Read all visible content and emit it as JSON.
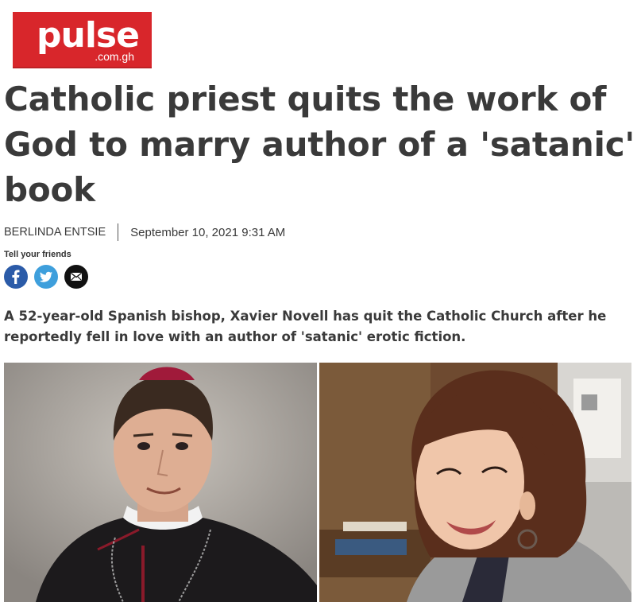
{
  "logo": {
    "brand": "pulse",
    "domain": ".com.gh"
  },
  "article": {
    "headline": "Catholic priest quits the work of God to marry author of a 'satanic' book",
    "author": "BERLINDA ENTSIE",
    "date": "September 10, 2021 9:31 AM",
    "lede": "A 52-year-old Spanish bishop, Xavier Novell has quit the Catholic Church after he reportedly fell in love with an author of 'satanic' erotic fiction."
  },
  "share": {
    "label": "Tell your friends",
    "icons": [
      "facebook-icon",
      "twitter-icon",
      "email-icon"
    ]
  },
  "colors": {
    "brand_red": "#d8262b",
    "text": "#3a3a3a",
    "facebook": "#2b5ba8",
    "twitter": "#3e9fdc",
    "email": "#111111"
  }
}
